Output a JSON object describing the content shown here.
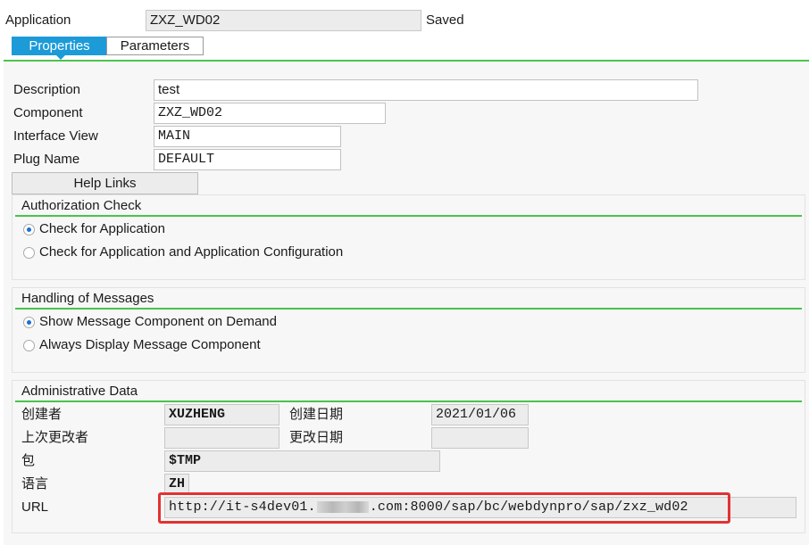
{
  "header": {
    "application_label": "Application",
    "application_value": "ZXZ_WD02",
    "status": "Saved"
  },
  "tabs": [
    {
      "label": "Properties",
      "active": true
    },
    {
      "label": "Parameters",
      "active": false
    }
  ],
  "properties": {
    "description_label": "Description",
    "description_value": "test",
    "component_label": "Component",
    "component_value": "ZXZ_WD02",
    "interface_view_label": "Interface View",
    "interface_view_value": "MAIN",
    "plug_name_label": "Plug Name",
    "plug_name_value": "DEFAULT",
    "help_links_button": "Help Links"
  },
  "authorization_check": {
    "title": "Authorization Check",
    "options": [
      {
        "label": "Check for Application",
        "selected": true
      },
      {
        "label": "Check for Application and Application Configuration",
        "selected": false
      }
    ]
  },
  "handling_of_messages": {
    "title": "Handling of Messages",
    "options": [
      {
        "label": "Show Message Component on Demand",
        "selected": true
      },
      {
        "label": "Always Display Message Component",
        "selected": false
      }
    ]
  },
  "administrative_data": {
    "title": "Administrative Data",
    "created_by_label": "创建者",
    "created_by_value": "XUZHENG",
    "created_on_label": "创建日期",
    "created_on_value": "2021/01/06",
    "changed_by_label": "上次更改者",
    "changed_by_value": "",
    "changed_on_label": "更改日期",
    "changed_on_value": "",
    "package_label": "包",
    "package_value": "$TMP",
    "language_label": "语言",
    "language_value": "ZH",
    "url_label": "URL",
    "url_prefix": "http://it-s4dev01.",
    "url_suffix": ".com:8000/sap/bc/webdynpro/sap/zxz_wd02"
  },
  "colors": {
    "accent_blue": "#1c9bd8",
    "group_line_green": "#4cc24c",
    "highlight_red": "#e23232"
  }
}
